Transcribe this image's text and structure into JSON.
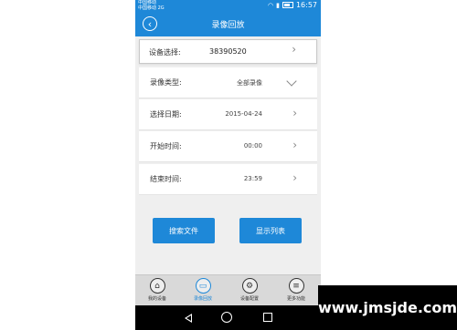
{
  "statusbar": {
    "carrier_line1": "中国移动",
    "carrier_line2": "中国移动 2G",
    "time": "16:57"
  },
  "header": {
    "title": "录像回放"
  },
  "form": {
    "device_label": "设备选择:",
    "device_value": "38390520",
    "type_label": "录像类型:",
    "type_value": "全部录像",
    "date_label": "选择日期:",
    "date_value": "2015-04-24",
    "start_label": "开始时间:",
    "start_value": "00:00",
    "end_label": "结束时间:",
    "end_value": "23:59"
  },
  "buttons": {
    "search": "搜索文件",
    "list": "显示列表"
  },
  "tabs": [
    {
      "label": "我的设备",
      "icon": "home-icon"
    },
    {
      "label": "录像回放",
      "icon": "monitor-icon"
    },
    {
      "label": "设备配置",
      "icon": "gear-icon"
    },
    {
      "label": "更多功能",
      "icon": "menu-icon"
    }
  ],
  "watermark": {
    "text": "www.jmsjde.com"
  },
  "colors": {
    "accent": "#1e88d8"
  }
}
